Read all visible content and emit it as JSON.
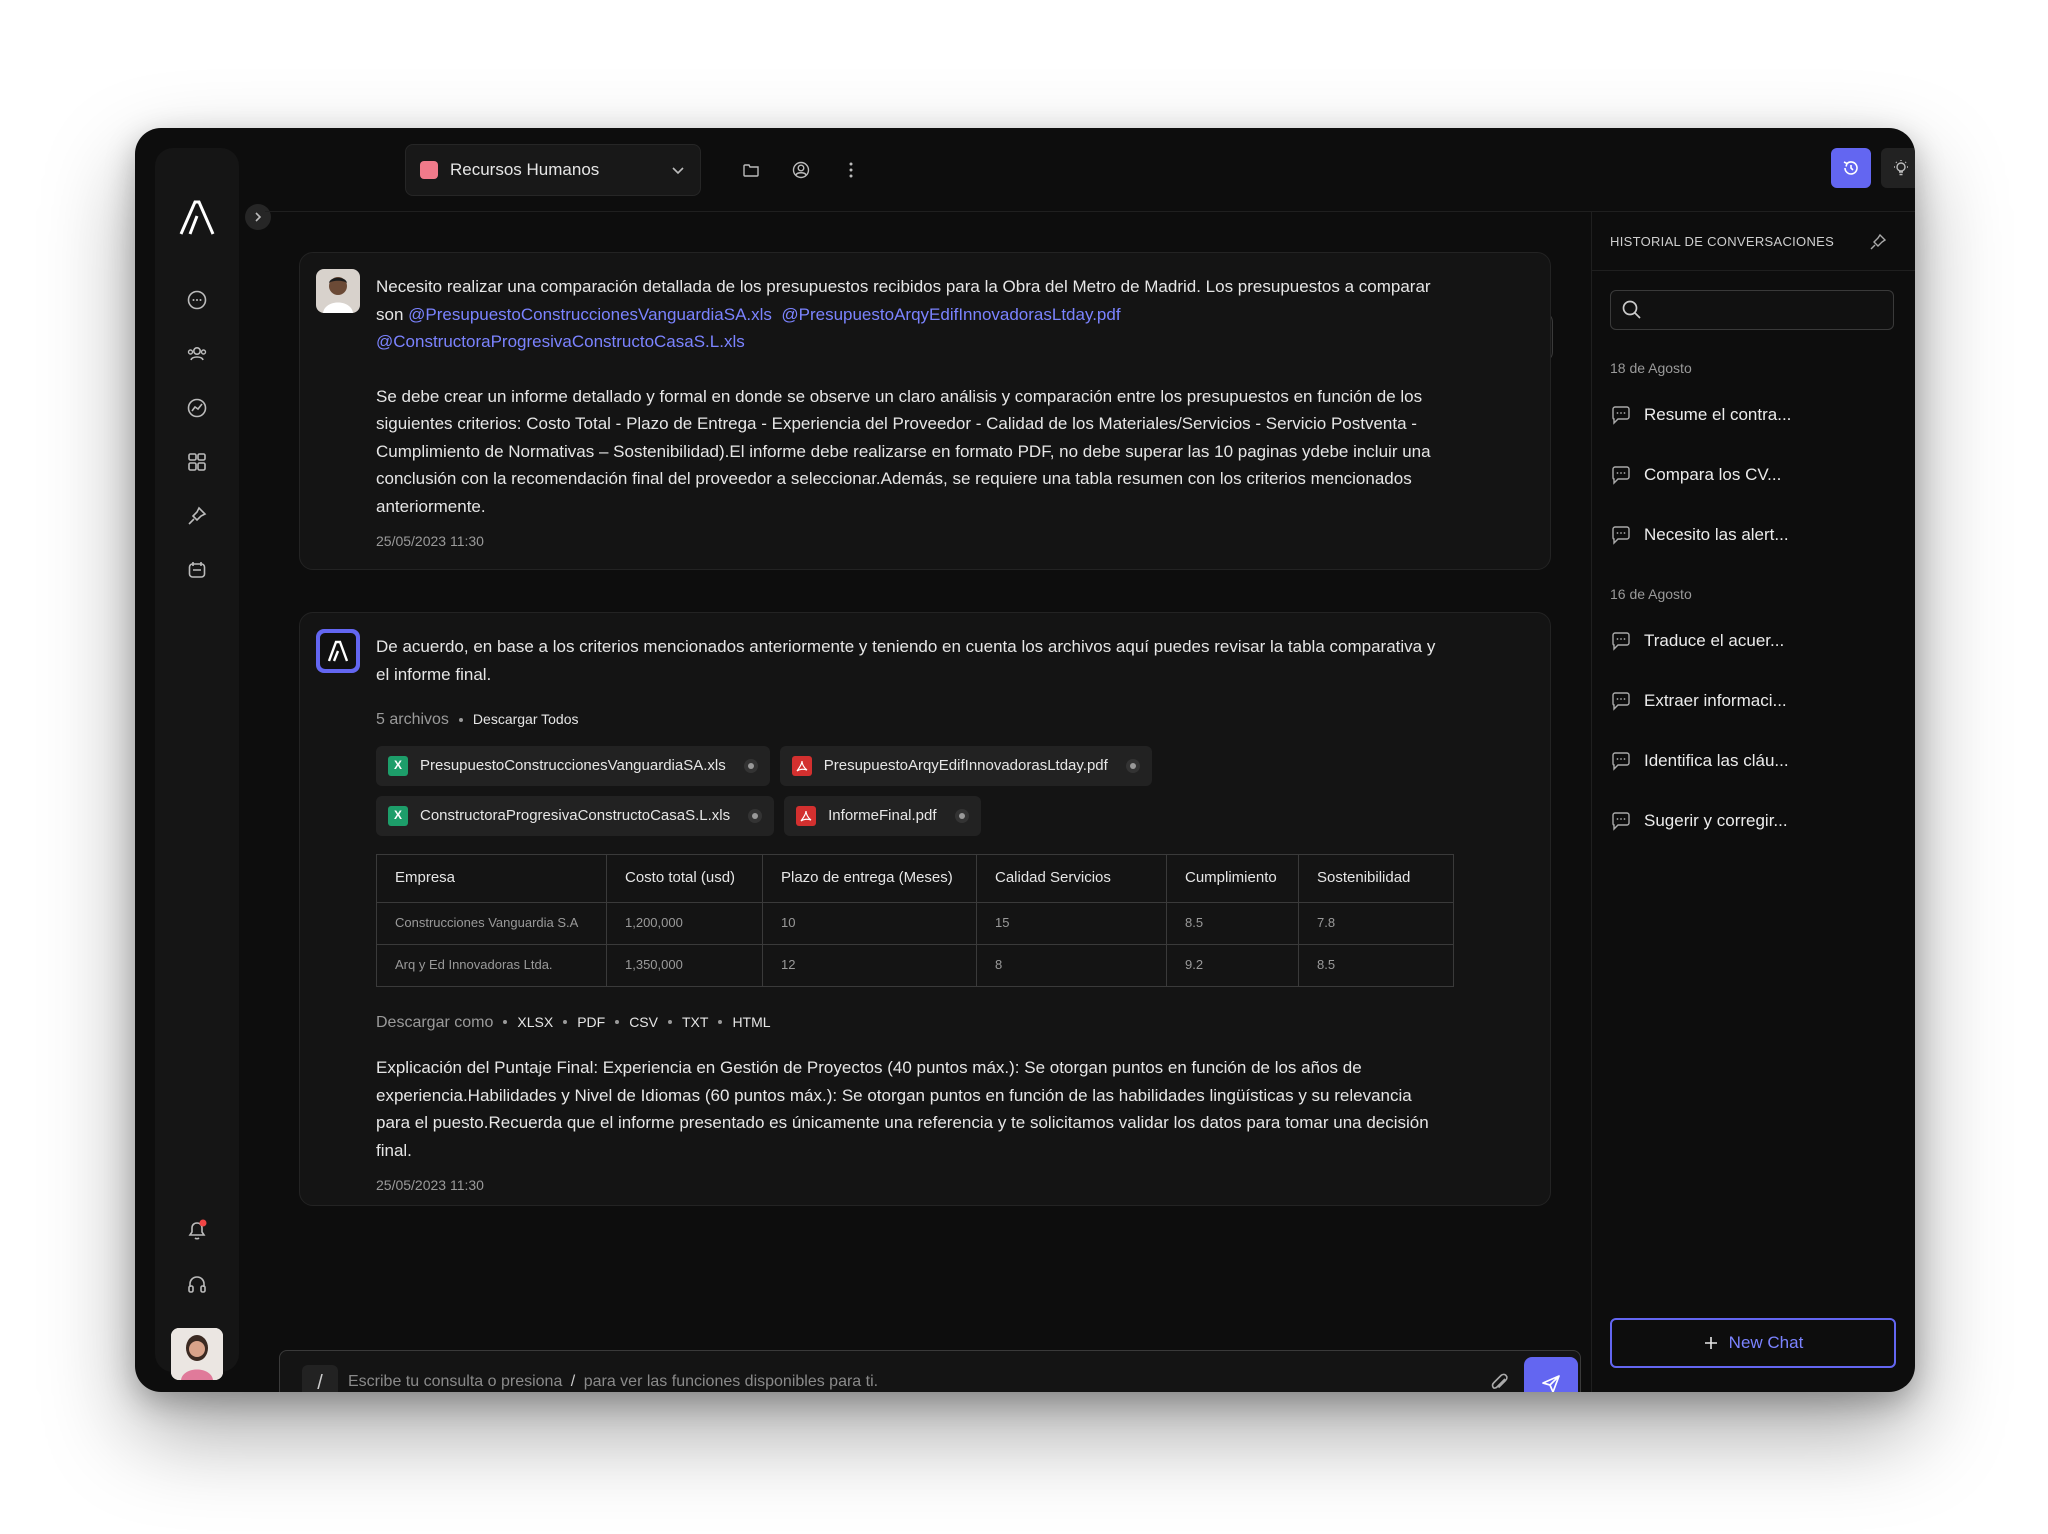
{
  "workspace": {
    "name": "Recursos Humanos",
    "color": "#f07a8a"
  },
  "user_message": {
    "intro": "Necesito realizar una comparación detallada de los presupuestos recibidos para la Obra del Metro de Madrid. Los presupuestos a comparar son",
    "mentions": [
      "@PresupuestoConstruccionesVanguardiaSA.xls",
      "@PresupuestoArqyEdifInnovadorasLtday.pdf",
      "@ConstructoraProgresivaConstructoCasaS.L.xls"
    ],
    "body": "Se debe crear un informe detallado y formal en donde se observe un claro análisis y comparación entre los presupuestos en función de los siguientes criterios: Costo Total - Plazo de Entrega - Experiencia del Proveedor - Calidad de los Materiales/Servicios - Servicio Postventa - Cumplimiento de Normativas – Sostenibilidad).El informe debe realizarse en formato PDF, no debe superar las 10 paginas ydebe incluir una conclusión con la recomendación final del proveedor a seleccionar.Además, se requiere una tabla resumen con los criterios mencionados anteriormente.",
    "timestamp": "25/05/2023  11:30"
  },
  "assistant_message": {
    "intro": "De acuerdo, en base a los criterios mencionados anteriormente y teniendo en cuenta los archivos aquí puedes revisar la tabla comparativa y el informe final.",
    "files_count": "5 archivos",
    "download_all": "Descargar Todos",
    "files": [
      {
        "name": "PresupuestoConstruccionesVanguardiaSA.xls",
        "type": "xls"
      },
      {
        "name": "PresupuestoArqyEdifInnovadorasLtday.pdf",
        "type": "pdf"
      },
      {
        "name": "ConstructoraProgresivaConstructoCasaS.L.xls",
        "type": "xls"
      },
      {
        "name": "InformeFinal.pdf",
        "type": "pdf"
      }
    ],
    "table": {
      "headers": [
        "Empresa",
        "Costo total (usd)",
        "Plazo de entrega (Meses)",
        "Calidad Servicios",
        "Cumplimiento",
        "Sostenibilidad"
      ],
      "rows": [
        [
          "Construcciones Vanguardia S.A",
          "1,200,000",
          "10",
          "15",
          "8.5",
          "7.8"
        ],
        [
          "Arq y Ed Innovadoras Ltda.",
          "1,350,000",
          "12",
          "8",
          "9.2",
          "8.5"
        ]
      ]
    },
    "download_as_label": "Descargar como",
    "download_formats": [
      "XLSX",
      "PDF",
      "CSV",
      "TXT",
      "HTML"
    ],
    "explanation": "Explicación del Puntaje Final: Experiencia en Gestión de Proyectos (40 puntos máx.): Se otorgan puntos en función de los años de experiencia.Habilidades y Nivel de Idiomas (60 puntos máx.): Se otorgan puntos en función de las habilidades lingüísticas y su relevancia para el puesto.Recuerda que el informe presentado es únicamente una referencia y te solicitamos validar los datos para tomar una decisión final.",
    "timestamp": "25/05/2023  11:30"
  },
  "composer": {
    "slash": "/",
    "placeholder_a": "Escribe tu consulta o presiona",
    "placeholder_slash": "/",
    "placeholder_b": "para ver las funciones disponibles para ti."
  },
  "history": {
    "title": "HISTORIAL DE CONVERSACIONES",
    "groups": [
      {
        "date": "18 de Agosto",
        "items": [
          "Resume el contra...",
          "Compara los CV...",
          "Necesito las alert..."
        ]
      },
      {
        "date": "16 de Agosto",
        "items": [
          "Traduce el acuer...",
          "Extraer informaci...",
          "Identifica las cláu...",
          "Sugerir y corregir..."
        ]
      }
    ],
    "new_chat": "New Chat"
  },
  "colors": {
    "accent": "#6366f1",
    "background": "#0d0d0d",
    "mention": "#7b83ff"
  }
}
